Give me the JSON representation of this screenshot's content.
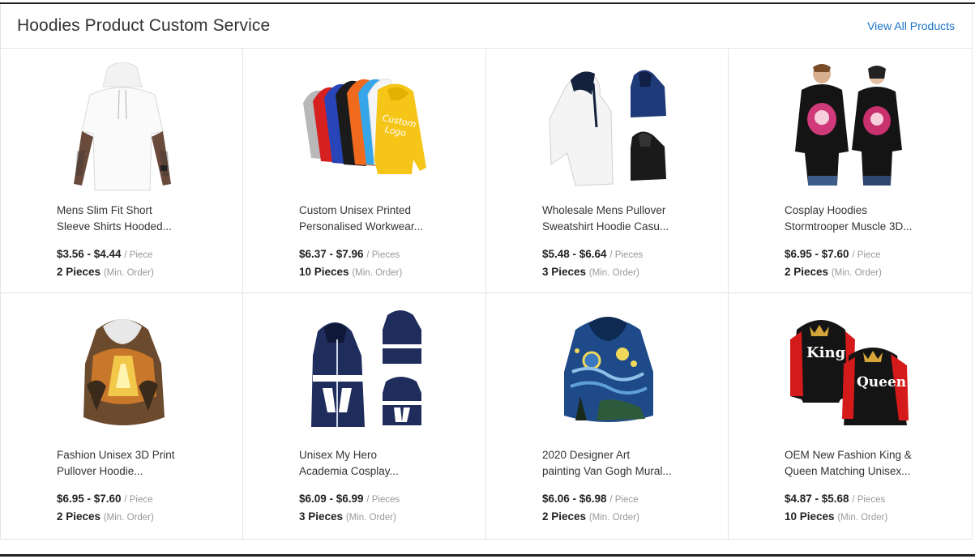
{
  "section": {
    "title": "Hoodies Product Custom Service",
    "view_all_label": "View All Products"
  },
  "products": [
    {
      "name_line1": "Mens Slim Fit Short",
      "name_line2": "Sleeve Shirts Hooded...",
      "price": "$3.56 - $4.44",
      "unit": "/ Piece",
      "moq": "2 Pieces",
      "moq_label": "(Min. Order)",
      "image_icon": "white-hooded-tshirt-image"
    },
    {
      "name_line1": "Custom Unisex Printed",
      "name_line2": "Personalised Workwear...",
      "price": "$6.37 - $7.96",
      "unit": "/ Pieces",
      "moq": "10 Pieces",
      "moq_label": "(Min. Order)",
      "image_icon": "colorful-hoodies-image",
      "image_text_1": "Custom",
      "image_text_2": "Logo"
    },
    {
      "name_line1": "Wholesale Mens Pullover",
      "name_line2": "Sweatshirt Hoodie Casu...",
      "price": "$5.48 - $6.64",
      "unit": "/ Pieces",
      "moq": "3 Pieces",
      "moq_label": "(Min. Order)",
      "image_icon": "white-navy-black-hoodies-image"
    },
    {
      "name_line1": "Cosplay Hoodies",
      "name_line2": "Stormtrooper Muscle 3D...",
      "price": "$6.95 - $7.60",
      "unit": "/ Piece",
      "moq": "2 Pieces",
      "moq_label": "(Min. Order)",
      "image_icon": "couple-printed-hoodies-image"
    },
    {
      "name_line1": "Fashion Unisex 3D Print",
      "name_line2": "Pullover Hoodie...",
      "price": "$6.95 - $7.60",
      "unit": "/ Piece",
      "moq": "2 Pieces",
      "moq_label": "(Min. Order)",
      "image_icon": "3d-print-hoodie-image"
    },
    {
      "name_line1": "Unisex My Hero",
      "name_line2": "Academia Cosplay...",
      "price": "$6.09 - $6.99",
      "unit": "/ Pieces",
      "moq": "3 Pieces",
      "moq_label": "(Min. Order)",
      "image_icon": "cosplay-hoodies-image"
    },
    {
      "name_line1": "2020 Designer Art",
      "name_line2": "painting Van Gogh Mural...",
      "price": "$6.06 - $6.98",
      "unit": "/ Piece",
      "moq": "2 Pieces",
      "moq_label": "(Min. Order)",
      "image_icon": "starry-night-hoodie-image"
    },
    {
      "name_line1": "OEM New Fashion King &",
      "name_line2": "Queen Matching Unisex...",
      "price": "$4.87 - $5.68",
      "unit": "/ Pieces",
      "moq": "10 Pieces",
      "moq_label": "(Min. Order)",
      "image_icon": "king-queen-hoodies-image",
      "image_text_1": "King",
      "image_text_2": "Queen"
    }
  ],
  "colors": {
    "link": "#1a73c8",
    "border": "#e5e5e5",
    "muted_text": "#999999"
  }
}
